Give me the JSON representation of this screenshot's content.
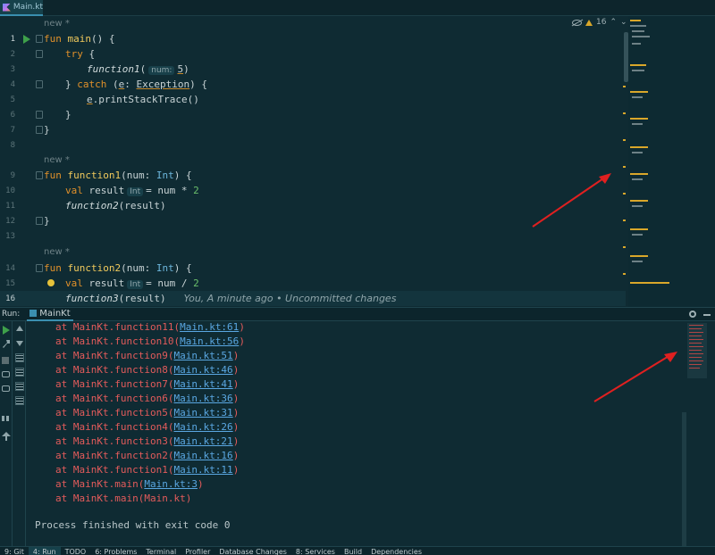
{
  "tab": {
    "filename": "Main.kt"
  },
  "editor": {
    "inspections": {
      "count": "16"
    },
    "hint_new": "new *",
    "blame": "You, A minute ago • Uncommitted changes",
    "line_numbers": [
      "1",
      "2",
      "3",
      "4",
      "5",
      "6",
      "7",
      "8",
      "9",
      "10",
      "11",
      "12",
      "13",
      "14",
      "15",
      "16"
    ],
    "inlay": {
      "num": "num:",
      "int": "Int"
    },
    "tokens": {
      "fun": "fun",
      "main": "main",
      "try": "try",
      "catch": "catch",
      "val": "val",
      "function1": "function1",
      "function2": "function2",
      "function3": "function3",
      "e": "e",
      "exception": "Exception",
      "int": "Int",
      "result": "result",
      "num": "num",
      "five": "5",
      "two": "2",
      "print": ".printStackTrace()",
      "open_paren_close": "() {",
      "brace_open": "{",
      "brace_close": "}",
      "catch_open": "} catch (",
      "colon": ": ",
      "paren_brace": ") {",
      "paren_open": "(",
      "paren_close": ")",
      "num_param": "(num: ",
      "eq_mul": "= num * ",
      "eq_div": "= num / ",
      "call_result": "(result)"
    }
  },
  "run_panel": {
    "label": "Run:",
    "tab": "MainKt",
    "output": [
      {
        "prefix": "at MainKt.function11(",
        "link": "Main.kt:61",
        "suffix": ")"
      },
      {
        "prefix": "at MainKt.function10(",
        "link": "Main.kt:56",
        "suffix": ")"
      },
      {
        "prefix": "at MainKt.function9(",
        "link": "Main.kt:51",
        "suffix": ")"
      },
      {
        "prefix": "at MainKt.function8(",
        "link": "Main.kt:46",
        "suffix": ")"
      },
      {
        "prefix": "at MainKt.function7(",
        "link": "Main.kt:41",
        "suffix": ")"
      },
      {
        "prefix": "at MainKt.function6(",
        "link": "Main.kt:36",
        "suffix": ")"
      },
      {
        "prefix": "at MainKt.function5(",
        "link": "Main.kt:31",
        "suffix": ")"
      },
      {
        "prefix": "at MainKt.function4(",
        "link": "Main.kt:26",
        "suffix": ")"
      },
      {
        "prefix": "at MainKt.function3(",
        "link": "Main.kt:21",
        "suffix": ")"
      },
      {
        "prefix": "at MainKt.function2(",
        "link": "Main.kt:16",
        "suffix": ")"
      },
      {
        "prefix": "at MainKt.function1(",
        "link": "Main.kt:11",
        "suffix": ")"
      },
      {
        "prefix": "at MainKt.main(",
        "link": "Main.kt:3",
        "suffix": ")"
      },
      {
        "prefix": "at MainKt.main(Main.kt)",
        "link": "",
        "suffix": ""
      }
    ],
    "exit_message": "Process finished with exit code 0"
  },
  "status_bar": {
    "items": [
      "9: Git",
      "4: Run",
      "TODO",
      "6: Problems",
      "Terminal",
      "Profiler",
      "Database Changes",
      "8: Services",
      "Build",
      "Dependencies"
    ]
  },
  "colors": {
    "accent": "#3a8fb0",
    "error_text": "#e35b5b",
    "link": "#5aa7e2",
    "annotation_arrow": "#e02020"
  }
}
